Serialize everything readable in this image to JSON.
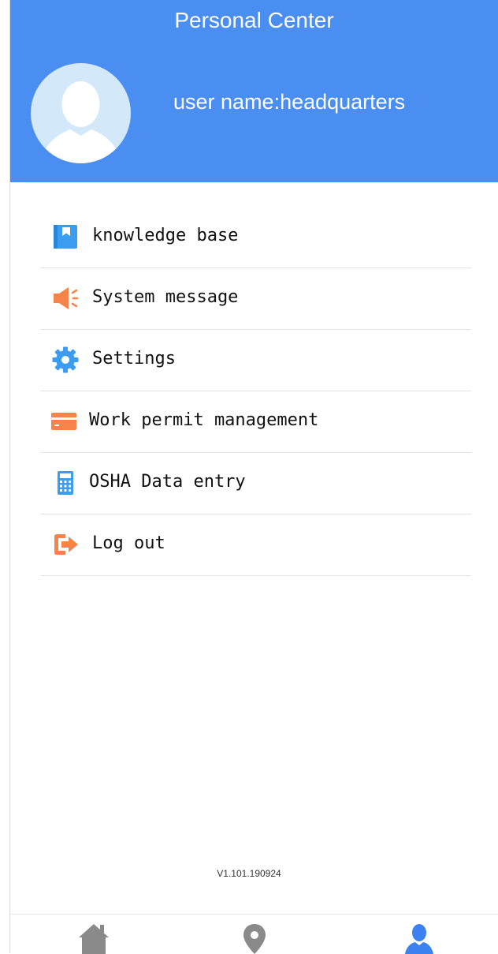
{
  "header": {
    "title": "Personal Center",
    "username": "user name:headquarters",
    "color": "#4a8ef2"
  },
  "menu": {
    "items": [
      {
        "label": "knowledge base",
        "icon": "book-icon",
        "color": "#3b9cf0"
      },
      {
        "label": "System message",
        "icon": "megaphone-icon",
        "color": "#f5834a"
      },
      {
        "label": "Settings",
        "icon": "gear-icon",
        "color": "#3b9cf0"
      },
      {
        "label": "Work permit management",
        "icon": "card-icon",
        "color": "#f5834a"
      },
      {
        "label": "OSHA Data entry",
        "icon": "calculator-icon",
        "color": "#3b9cf0"
      },
      {
        "label": "Log out",
        "icon": "logout-icon",
        "color": "#f5834a"
      }
    ]
  },
  "footer": {
    "version": "V1.101.190924"
  },
  "tabbar": {
    "tabs": [
      {
        "icon": "home-icon",
        "active": false
      },
      {
        "icon": "location-pin-icon",
        "active": false
      },
      {
        "icon": "user-icon",
        "active": true
      }
    ],
    "active_color": "#3b82f0",
    "inactive_color": "#8a8a8a"
  }
}
